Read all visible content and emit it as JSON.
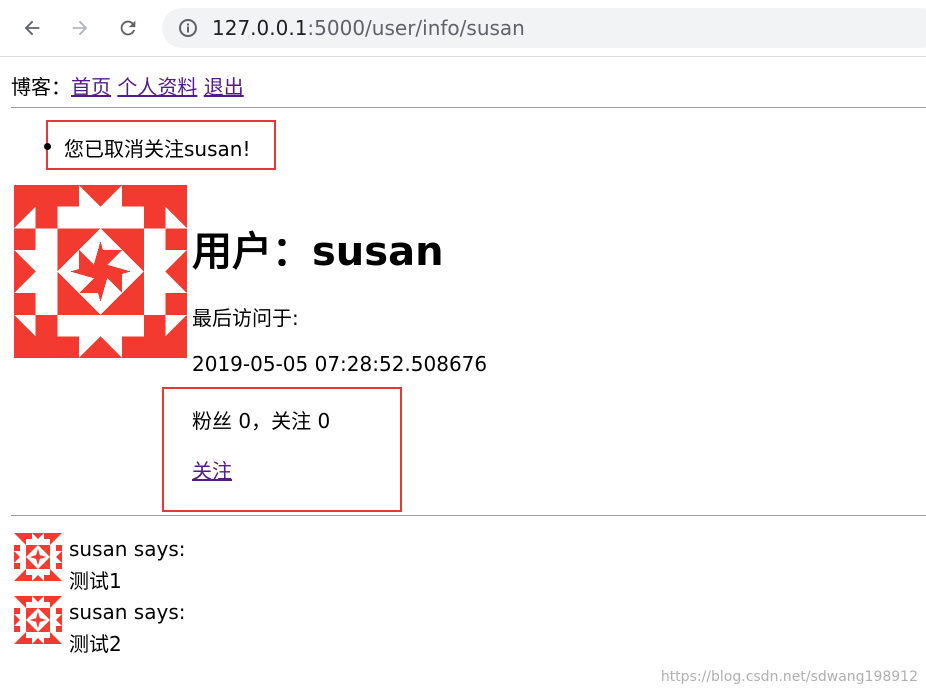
{
  "browser": {
    "url_host": "127.0.0.1",
    "url_path": ":5000/user/info/susan"
  },
  "nav": {
    "label": "博客：",
    "links": [
      "首页",
      "个人资料",
      "退出"
    ]
  },
  "flash": {
    "message": "您已取消关注susan!"
  },
  "profile": {
    "title": "用户：susan",
    "last_seen_label": "最后访问于:",
    "last_seen_time": "2019-05-05 07:28:52.508676",
    "counts": "粉丝 0，关注 0",
    "follow_link": "关注"
  },
  "posts": [
    {
      "author": "susan says:",
      "body": "测试1"
    },
    {
      "author": "susan says:",
      "body": "测试2"
    }
  ],
  "watermark": "https://blog.csdn.net/sdwang198912",
  "colors": {
    "avatar": "#f33a30",
    "highlight_box": "#e53935",
    "link": "#551a8b"
  }
}
